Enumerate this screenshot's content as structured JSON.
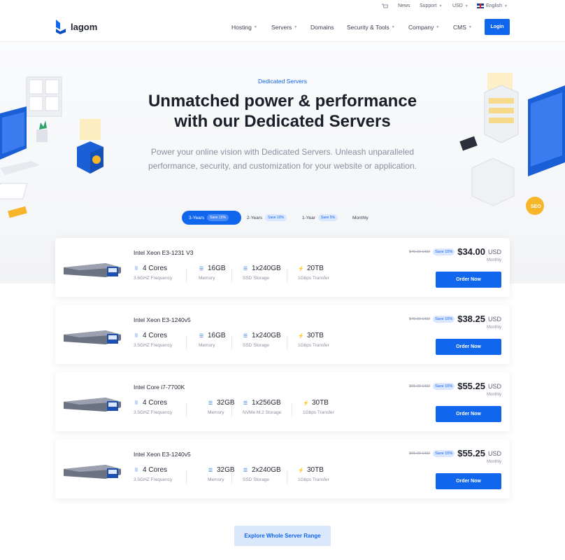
{
  "topbar": {
    "news": "News",
    "support": "Support",
    "currency": "USD",
    "language": "English"
  },
  "brand": {
    "name": "lagom",
    "accent": "#1166ee"
  },
  "nav": {
    "items": [
      "Hosting",
      "Servers",
      "Domains",
      "Security & Tools",
      "Company",
      "CMS"
    ],
    "login": "Login"
  },
  "hero": {
    "eyebrow": "Dedicated Servers",
    "title_line1": "Unmatched power & performance",
    "title_line2": "with our Dedicated Servers",
    "subtitle_line1": "Power your online vision with Dedicated Servers. Unleash unparalleled",
    "subtitle_line2": "performance, security, and customization for your website or application."
  },
  "periods": [
    {
      "label": "3-Years",
      "save": "Save 15%",
      "active": true
    },
    {
      "label": "2-Years",
      "save": "Save 10%",
      "active": false
    },
    {
      "label": "1-Year",
      "save": "Save 5%",
      "active": false
    },
    {
      "label": "Monthly",
      "save": "",
      "active": false
    }
  ],
  "servers": [
    {
      "name": "Intel Xeon E3-1231 V3",
      "specs": [
        {
          "value": "4 Cores",
          "label": "3.6GHZ Frequency"
        },
        {
          "value": "16GB",
          "label": "Memory"
        },
        {
          "value": "1x240GB",
          "label": "SSD Storage"
        },
        {
          "value": "20TB",
          "label": "1Gbps Transfer"
        }
      ],
      "old_price": "$40.00 USD",
      "save": "Save 15%",
      "price": "$34.00",
      "currency": "USD",
      "period": "Monthly",
      "button": "Order Now"
    },
    {
      "name": "Intel Xeon E3-1240v5",
      "specs": [
        {
          "value": "4 Cores",
          "label": "3.5GHZ Frequency"
        },
        {
          "value": "16GB",
          "label": "Memory"
        },
        {
          "value": "1x240GB",
          "label": "SSD Storage"
        },
        {
          "value": "30TB",
          "label": "1Gbps Transfer"
        }
      ],
      "old_price": "$49.00 USD",
      "save": "Save 15%",
      "price": "$38.25",
      "currency": "USD",
      "period": "Monthly",
      "button": "Order Now"
    },
    {
      "name": "Intel Core i7-7700K",
      "specs": [
        {
          "value": "4 Cores",
          "label": "3.5GHZ Frequency"
        },
        {
          "value": "32GB",
          "label": "Memory"
        },
        {
          "value": "1x256GB",
          "label": "NVMe M.2 Storage"
        },
        {
          "value": "30TB",
          "label": "1Gbps Transfer"
        }
      ],
      "old_price": "$65.00 USD",
      "save": "Save 15%",
      "price": "$55.25",
      "currency": "USD",
      "period": "Monthly",
      "button": "Order Now"
    },
    {
      "name": "Intel Xeon E3-1240v5",
      "specs": [
        {
          "value": "4 Cores",
          "label": "3.5GHZ Frequency"
        },
        {
          "value": "32GB",
          "label": "Memory"
        },
        {
          "value": "2x240GB",
          "label": "SSD Storage"
        },
        {
          "value": "30TB",
          "label": "1Gbps Transfer"
        }
      ],
      "old_price": "$65.00 USD",
      "save": "Save 15%",
      "price": "$55.25",
      "currency": "USD",
      "period": "Monthly",
      "button": "Order Now"
    }
  ],
  "explore": "Explore Whole Server Range",
  "deco_badge": "SEO"
}
